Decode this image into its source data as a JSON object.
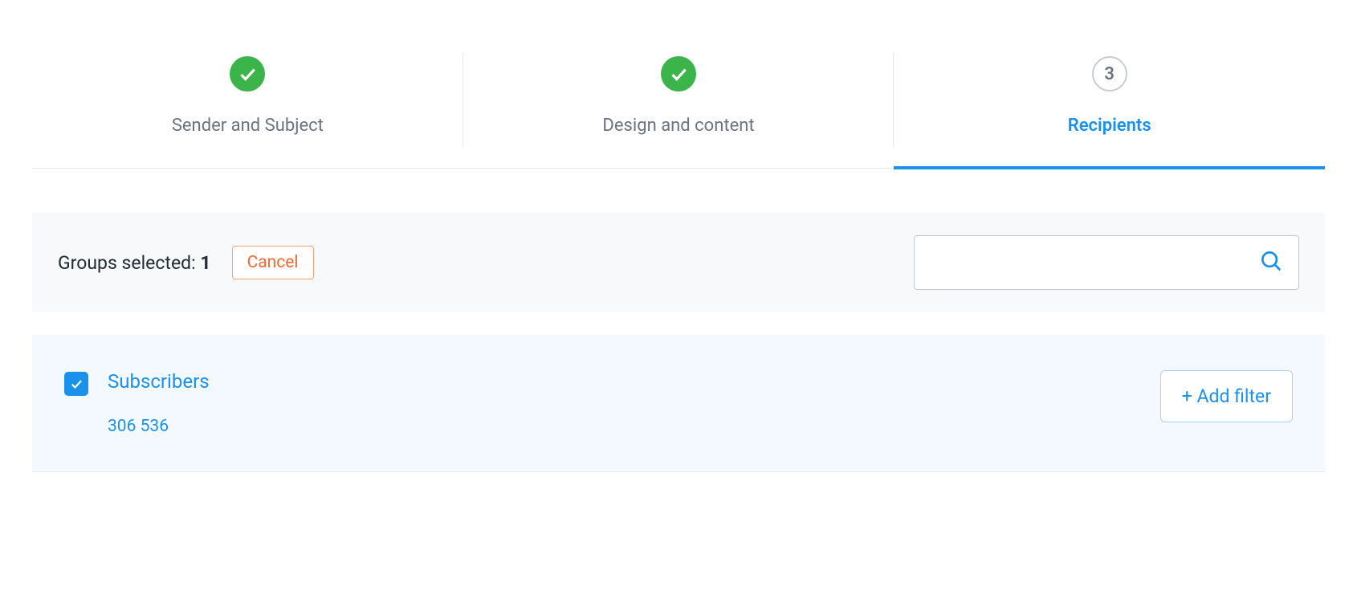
{
  "stepper": {
    "steps": [
      {
        "label": "Sender and Subject",
        "state": "complete"
      },
      {
        "label": "Design and content",
        "state": "complete"
      },
      {
        "label": "Recipients",
        "state": "active",
        "number": "3"
      }
    ]
  },
  "selection": {
    "label_prefix": "Groups selected: ",
    "count": "1",
    "cancel_label": "Cancel"
  },
  "search": {
    "placeholder": ""
  },
  "groups": [
    {
      "name": "Subscribers",
      "count": "306 536",
      "checked": true
    }
  ],
  "actions": {
    "add_filter_label": "+ Add filter"
  }
}
